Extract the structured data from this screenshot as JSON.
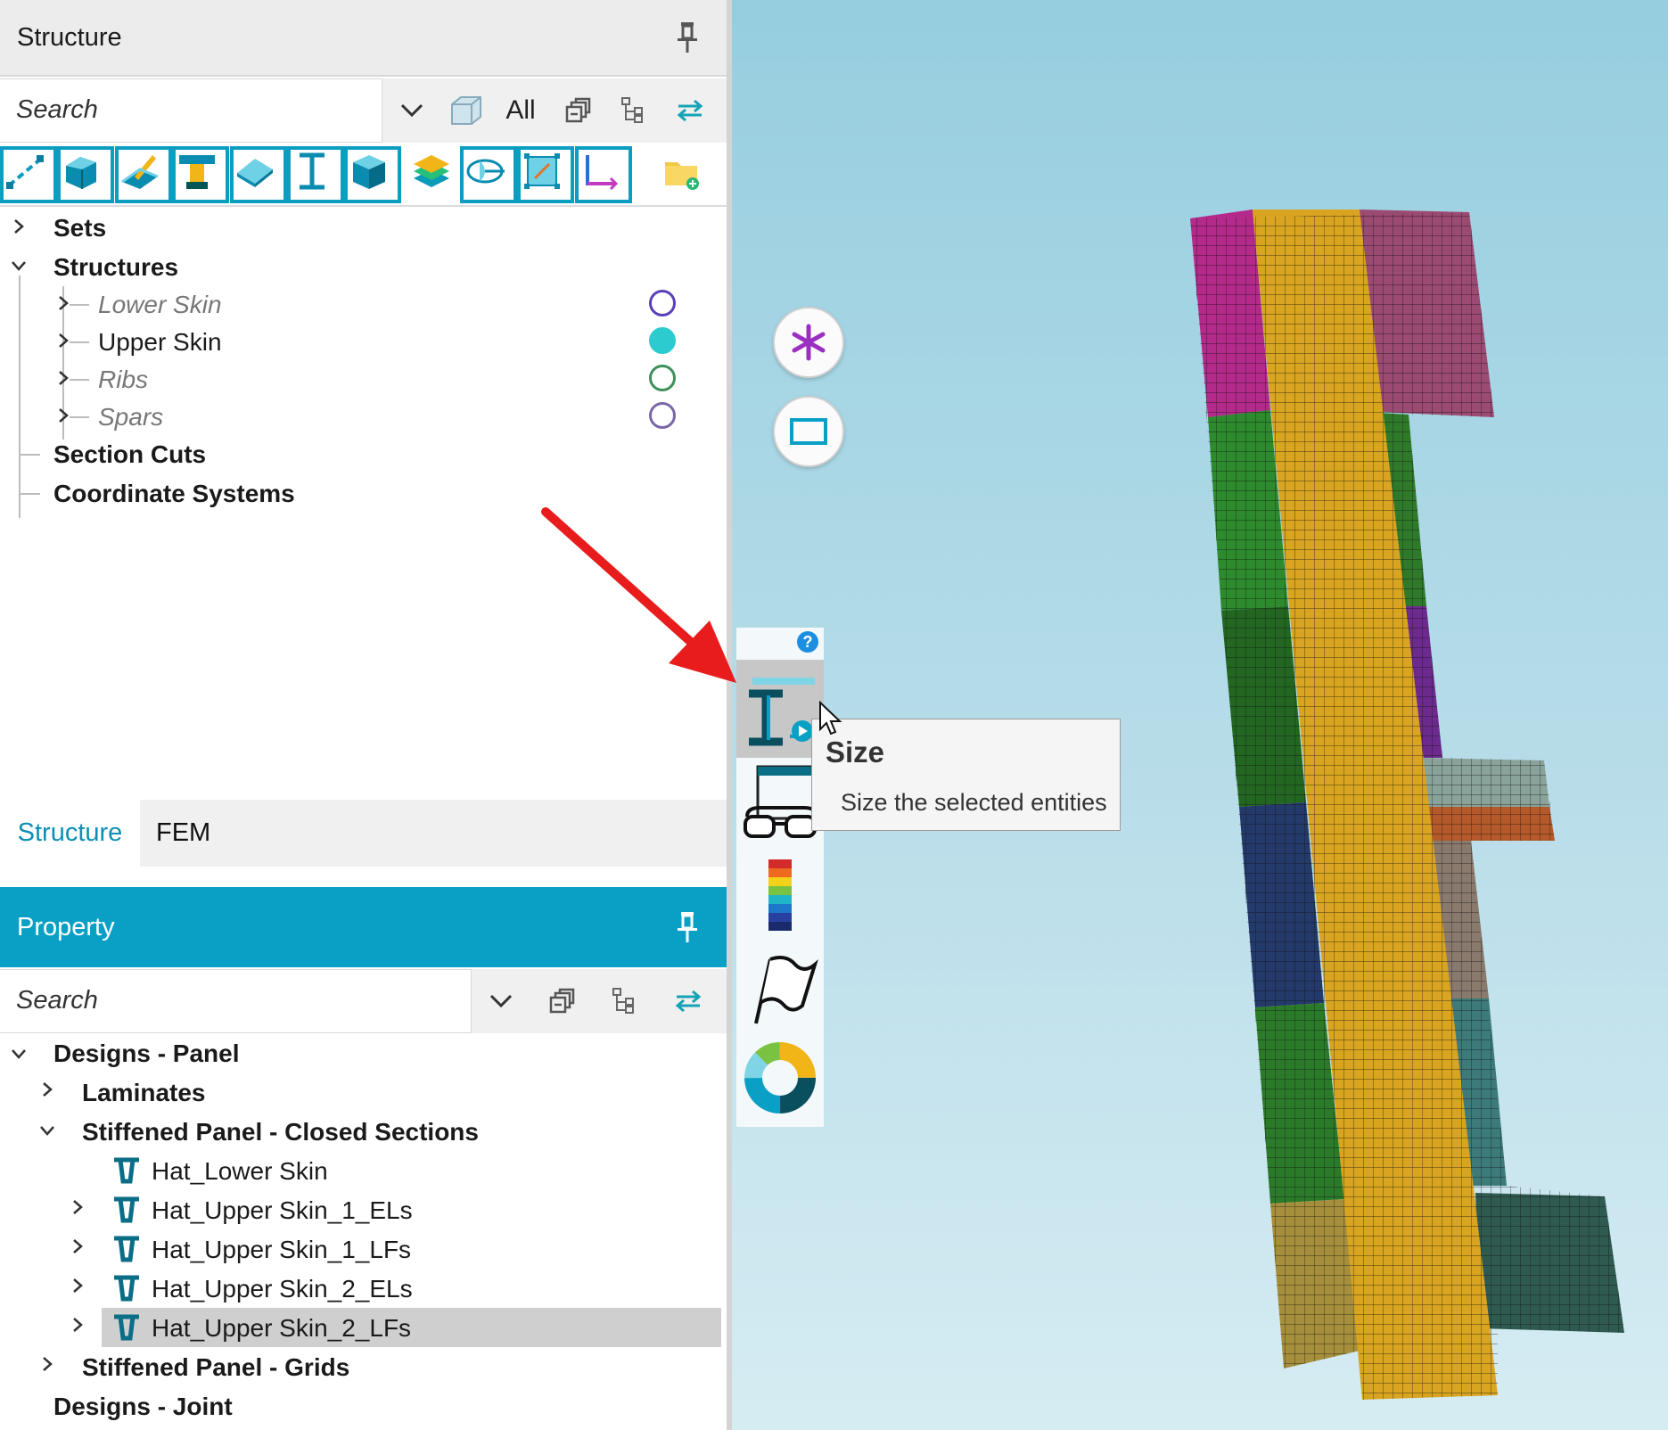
{
  "structure_panel": {
    "title": "Structure",
    "search_placeholder": "Search",
    "all_label": "All",
    "tree": {
      "sets": "Sets",
      "structures": "Structures",
      "children": [
        {
          "label": "Lower Skin",
          "style": "italic",
          "circle": "hollow",
          "color": "#5b3fb8"
        },
        {
          "label": "Upper Skin",
          "style": "normal",
          "circle": "filled",
          "color": "#2ccbcf"
        },
        {
          "label": "Ribs",
          "style": "italic",
          "circle": "hollow",
          "color": "#3f8f5a"
        },
        {
          "label": "Spars",
          "style": "italic",
          "circle": "hollow",
          "color": "#7a66a8"
        }
      ],
      "section_cuts": "Section Cuts",
      "coordinate_systems": "Coordinate Systems"
    }
  },
  "bottom_tabs": {
    "structure": "Structure",
    "fem": "FEM"
  },
  "property_panel": {
    "title": "Property",
    "search_placeholder": "Search",
    "tree": {
      "designs_panel": "Designs - Panel",
      "laminates": "Laminates",
      "stiffened_closed": "Stiffened Panel - Closed Sections",
      "items": [
        "Hat_Lower Skin",
        "Hat_Upper Skin_1_ELs",
        "Hat_Upper Skin_1_LFs",
        "Hat_Upper Skin_2_ELs",
        "Hat_Upper Skin_2_LFs"
      ],
      "stiffened_grids": "Stiffened Panel - Grids",
      "designs_joint": "Designs - Joint"
    }
  },
  "viewport": {
    "tooltip": {
      "title": "Size",
      "description": "Size the selected entities"
    },
    "icons": [
      "asterisk-icon",
      "rectangle-select-icon",
      "help-icon",
      "size-icon",
      "review-glasses-icon",
      "color-scale-icon",
      "flag-icon",
      "color-wheel-icon"
    ]
  },
  "colors": {
    "accent": "#0aa0c5",
    "tree_selected": "#cfcfcf",
    "annotation_arrow": "#e81c1c"
  }
}
